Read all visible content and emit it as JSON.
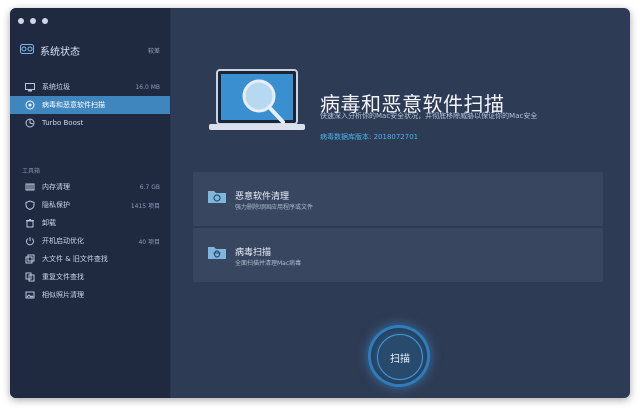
{
  "window": {
    "controls": [
      "close",
      "minimize",
      "maximize"
    ]
  },
  "sidebar": {
    "header": {
      "label": "系统状态",
      "badge": "较差",
      "icon": "dashboard-icon"
    },
    "items": [
      {
        "name": "system-junk",
        "label": "系统垃圾",
        "value": "16.0 MB",
        "icon": "monitor-icon",
        "active": false
      },
      {
        "name": "virus-scan",
        "label": "病毒和恶意软件扫描",
        "value": "",
        "icon": "shield-bug-icon",
        "active": true
      },
      {
        "name": "turbo-boost",
        "label": "Turbo Boost",
        "value": "",
        "icon": "turbo-icon",
        "active": false
      }
    ],
    "tools_label": "工具箱",
    "tools": [
      {
        "name": "memory-cleanup",
        "label": "内存清理",
        "value": "6.7 GB",
        "icon": "memory-icon"
      },
      {
        "name": "privacy",
        "label": "隐私保护",
        "value": "1415 项目",
        "icon": "privacy-shield-icon"
      },
      {
        "name": "uninstall",
        "label": "卸载",
        "value": "",
        "icon": "trash-icon"
      },
      {
        "name": "startup",
        "label": "开机启动优化",
        "value": "40 项目",
        "icon": "power-icon"
      },
      {
        "name": "large-files",
        "label": "大文件 & 旧文件查找",
        "value": "",
        "icon": "files-icon"
      },
      {
        "name": "duplicates",
        "label": "重复文件查找",
        "value": "",
        "icon": "duplicate-icon"
      },
      {
        "name": "similar-photos",
        "label": "相似照片清理",
        "value": "",
        "icon": "photo-icon"
      }
    ]
  },
  "main": {
    "title": "病毒和恶意软件扫描",
    "subtitle": "快速深入分析你的Mac安全状况，并彻底移除威胁以保证你的Mac安全",
    "db_version": "病毒数据库版本: 2018072701",
    "cards": [
      {
        "title": "恶意软件清理",
        "desc": "强力删除顽固应用程序或文件",
        "icon": "folder-gear-icon"
      },
      {
        "title": "病毒扫描",
        "desc": "全面扫描并清理Mac病毒",
        "icon": "folder-bug-icon"
      }
    ],
    "scan_button": "扫描"
  },
  "colors": {
    "sidebar_bg": "#1f2a40",
    "main_bg": "#2e3b54",
    "accent": "#3f86bf",
    "link": "#47b4f0"
  }
}
